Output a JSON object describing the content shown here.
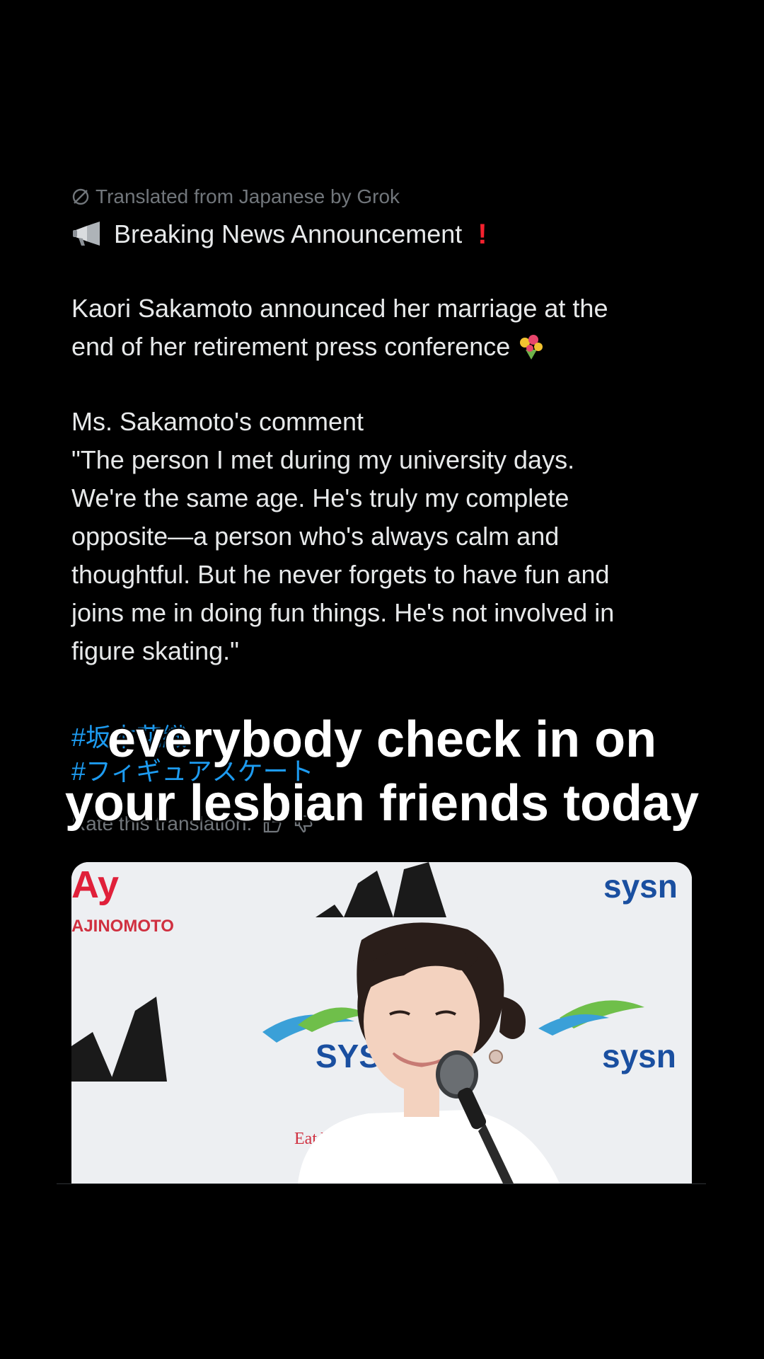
{
  "post": {
    "translated_label": "Translated from Japanese by Grok",
    "headline": "Breaking News Announcement",
    "paragraph1": "Kaori Sakamoto announced her marriage at the\nend of her retirement press conference",
    "comment_label": "Ms. Sakamoto's comment",
    "quote": "\"The person I met during my university days.\nWe're the same age. He's truly my complete\nopposite—a person who's always calm and\nthoughtful. But he never forgets to have fun and\njoins me in doing fun things. He's not involved in\nfigure skating.\"",
    "hashtags": [
      "#坂本花織",
      "#フィギュアスケート"
    ],
    "rate_label": "Rate this translation:"
  },
  "overlay": {
    "caption_line1": "everybody check in on",
    "caption_line2": "your lesbian friends today"
  },
  "photo": {
    "logos": [
      "AJINOMOTO",
      "SYSMEX",
      "Eat Well"
    ]
  }
}
